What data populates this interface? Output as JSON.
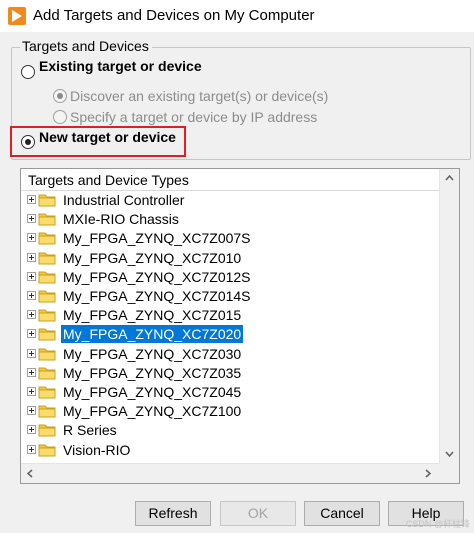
{
  "window": {
    "title": "Add Targets and Devices on My Computer"
  },
  "group": {
    "legend": "Targets and Devices",
    "existing_option": "Existing target or device",
    "discover_option": "Discover an existing target(s) or device(s)",
    "specify_option": "Specify a target or device by IP address",
    "new_option": "New target or device",
    "selected_radio": "new",
    "sub_selected_radio": "discover"
  },
  "tree": {
    "header": "Targets and Device Types",
    "items": [
      {
        "label": "Industrial Controller",
        "selected": false
      },
      {
        "label": "MXIe-RIO Chassis",
        "selected": false
      },
      {
        "label": "My_FPGA_ZYNQ_XC7Z007S",
        "selected": false
      },
      {
        "label": "My_FPGA_ZYNQ_XC7Z010",
        "selected": false
      },
      {
        "label": "My_FPGA_ZYNQ_XC7Z012S",
        "selected": false
      },
      {
        "label": "My_FPGA_ZYNQ_XC7Z014S",
        "selected": false
      },
      {
        "label": "My_FPGA_ZYNQ_XC7Z015",
        "selected": false
      },
      {
        "label": "My_FPGA_ZYNQ_XC7Z020",
        "selected": true
      },
      {
        "label": "My_FPGA_ZYNQ_XC7Z030",
        "selected": false
      },
      {
        "label": "My_FPGA_ZYNQ_XC7Z035",
        "selected": false
      },
      {
        "label": "My_FPGA_ZYNQ_XC7Z045",
        "selected": false
      },
      {
        "label": "My_FPGA_ZYNQ_XC7Z100",
        "selected": false
      },
      {
        "label": "R Series",
        "selected": false
      },
      {
        "label": "Vision-RIO",
        "selected": false
      }
    ]
  },
  "buttons": {
    "refresh": "Refresh",
    "ok": "OK",
    "cancel": "Cancel",
    "help": "Help"
  },
  "watermark": "CSDN @杆柱锋",
  "colors": {
    "selection": "#0078d7",
    "highlight_box": "#e02020",
    "app_icon": "#f08a1c",
    "folder": "#f5c842"
  },
  "icons": [
    "app-icon",
    "expand-plus-icon",
    "folder-icon",
    "scroll-up-arrow-icon",
    "scroll-down-arrow-icon",
    "scroll-left-arrow-icon",
    "scroll-right-arrow-icon"
  ]
}
